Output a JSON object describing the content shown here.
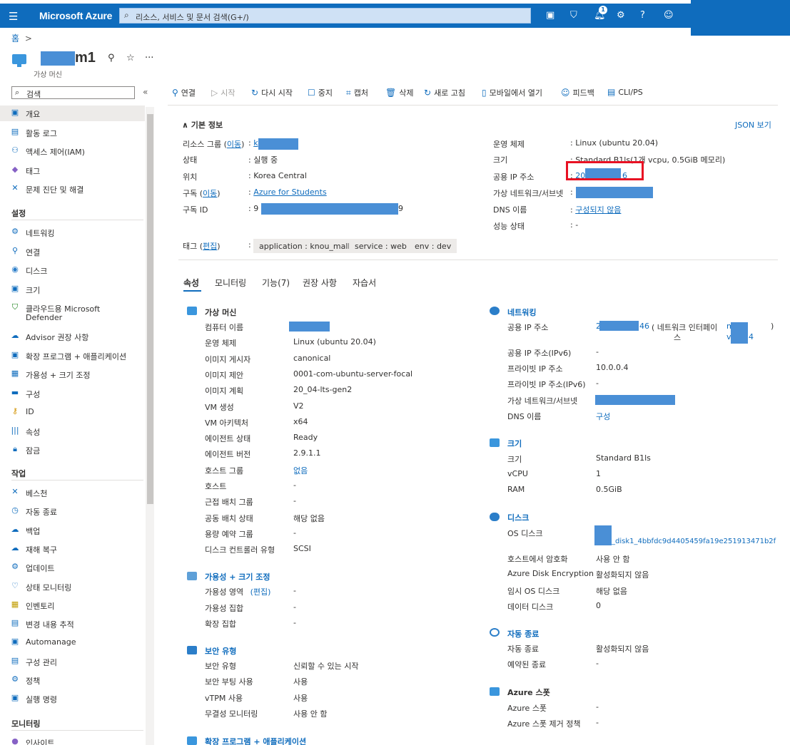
{
  "topbar": {
    "brand": "Microsoft Azure",
    "search_placeholder": "리소스, 서비스 및 문서 검색(G+/)",
    "notification_count": "1"
  },
  "breadcrumb": {
    "home": "홈",
    "sep": ">"
  },
  "header": {
    "title_suffix": "m1",
    "subtitle": "가상 머신"
  },
  "sidebar": {
    "search_placeholder": "검색",
    "items_top": [
      {
        "label": "개요",
        "icon": "monitor-icon",
        "selected": true
      },
      {
        "label": "활동 로그",
        "icon": "log-icon"
      },
      {
        "label": "액세스 제어(IAM)",
        "icon": "people-icon"
      },
      {
        "label": "태그",
        "icon": "tag-icon"
      },
      {
        "label": "문제 진단 및 해결",
        "icon": "wrench-icon"
      }
    ],
    "section_settings": "설정",
    "items_settings": [
      {
        "label": "네트워킹",
        "icon": "network-icon"
      },
      {
        "label": "연결",
        "icon": "connect-icon"
      },
      {
        "label": "디스크",
        "icon": "disk-icon"
      },
      {
        "label": "크기",
        "icon": "monitor-icon"
      },
      {
        "label": "클라우드용 Microsoft",
        "label2": "Defender",
        "icon": "shield-icon"
      },
      {
        "label": "Advisor 권장 사항",
        "icon": "advisor-icon"
      },
      {
        "label": "확장 프로그램 + 애플리케이션",
        "icon": "extension-icon"
      },
      {
        "label": "가용성 + 크기 조정",
        "icon": "scale-icon"
      },
      {
        "label": "구성",
        "icon": "config-icon"
      },
      {
        "label": "ID",
        "icon": "key-icon"
      },
      {
        "label": "속성",
        "icon": "properties-icon"
      },
      {
        "label": "잠금",
        "icon": "lock-icon"
      }
    ],
    "section_operations": "작업",
    "items_operations": [
      {
        "label": "베스천",
        "icon": "bastion-icon"
      },
      {
        "label": "자동 종료",
        "icon": "clock-icon"
      },
      {
        "label": "백업",
        "icon": "cloud-icon"
      },
      {
        "label": "재해 복구",
        "icon": "cloud-icon"
      },
      {
        "label": "업데이트",
        "icon": "gear-icon"
      },
      {
        "label": "상태 모니터링",
        "icon": "heart-icon"
      },
      {
        "label": "인벤토리",
        "icon": "box-icon"
      },
      {
        "label": "변경 내용 추적",
        "icon": "doc-icon"
      },
      {
        "label": "Automanage",
        "icon": "monitor-icon"
      },
      {
        "label": "구성 관리",
        "icon": "doc-icon"
      },
      {
        "label": "정책",
        "icon": "policy-icon"
      },
      {
        "label": "실행 명령",
        "icon": "terminal-icon"
      }
    ],
    "section_monitoring": "모니터링",
    "items_monitoring": [
      {
        "label": "인사이트",
        "icon": "bulb-icon"
      }
    ]
  },
  "toolbar": {
    "connect": "연결",
    "start": "시작",
    "restart": "다시 시작",
    "stop": "중지",
    "capture": "캡처",
    "delete": "삭제",
    "refresh": "새로 고침",
    "mobile": "모바일에서 열기",
    "feedback": "피드백",
    "cli": "CLI/PS"
  },
  "essentials": {
    "title": "기본 정보",
    "json_view": "JSON 보기",
    "left": {
      "resource_group_label": "리소스 그룹",
      "move": "이동",
      "status_label": "상태",
      "status_value": "실행 중",
      "location_label": "위치",
      "location_value": "Korea Central",
      "subscription_label": "구독",
      "subscription_value": "Azure for Students",
      "subscription_id_label": "구독 ID",
      "subscription_id_prefix": "9",
      "subscription_id_suffix": "9"
    },
    "right": {
      "os_label": "운영 체제",
      "os_value": "Linux (ubuntu 20.04)",
      "size_label": "크기",
      "size_value": "Standard B1ls(1개 vcpu, 0.5GiB 메모리)",
      "public_ip_label": "공용 IP 주소",
      "public_ip_prefix": "20",
      "public_ip_suffix": "6",
      "vnet_label": "가상 네트워크/서브넷",
      "dns_label": "DNS 이름",
      "dns_value": "구성되지 않음",
      "health_label": "성능 상태",
      "health_value": "-"
    },
    "tags_label": "태그",
    "tags_edit": "편집",
    "tags": [
      "application : knou_mall",
      "service : web",
      "env : dev"
    ]
  },
  "tabs": [
    "속성",
    "모니터링",
    "기능(7)",
    "권장 사항",
    "자습서"
  ],
  "properties": {
    "vm": {
      "title": "가상 머신",
      "rows": [
        [
          "컴퓨터 이름",
          ""
        ],
        [
          "운영 체제",
          "Linux (ubuntu 20.04)"
        ],
        [
          "이미지 게시자",
          "canonical"
        ],
        [
          "이미지 제안",
          "0001-com-ubuntu-server-focal"
        ],
        [
          "이미지 계획",
          "20_04-lts-gen2"
        ],
        [
          "VM 생성",
          "V2"
        ],
        [
          "VM 아키텍처",
          "x64"
        ],
        [
          "에이전트 상태",
          "Ready"
        ],
        [
          "에이전트 버전",
          "2.9.1.1"
        ],
        [
          "호스트 그룹",
          "없음"
        ],
        [
          "호스트",
          "-"
        ],
        [
          "근접 배치 그룹",
          "-"
        ],
        [
          "공동 배치 상태",
          "해당 없음"
        ],
        [
          "용량 예약 그룹",
          "-"
        ],
        [
          "디스크 컨트롤러 유형",
          "SCSI"
        ]
      ]
    },
    "availability": {
      "title": "가용성 + 크기 조정",
      "rows": [
        [
          "가용성 영역",
          "-"
        ],
        [
          "가용성 집합",
          "-"
        ],
        [
          "확장 집합",
          "-"
        ]
      ],
      "edit": "(편집)"
    },
    "security": {
      "title": "보안 유형",
      "rows": [
        [
          "보안 유형",
          "신뢰할 수 있는 시작"
        ],
        [
          "보안 부팅 사용",
          "사용"
        ],
        [
          "vTPM 사용",
          "사용"
        ],
        [
          "무결성 모니터링",
          "사용 안 함"
        ]
      ]
    },
    "extensions": {
      "title": "확장 프로그램 + 애플리케이션"
    },
    "networking": {
      "title": "네트워킹",
      "public_ip_label": "공용 IP 주소",
      "public_ip_prefix": "2",
      "public_ip_suffix": "46",
      "nic_text": "( 네트워크 인터페이",
      "nic_text2": "스",
      "nic_link1": "m",
      "nic_link2": "v",
      "nic_link3": "4",
      "close_paren": ")",
      "rows": [
        [
          "공용 IP 주소(IPv6)",
          "-"
        ],
        [
          "프라이빗 IP 주소",
          "10.0.0.4"
        ],
        [
          "프라이빗 IP 주소(IPv6)",
          "-"
        ]
      ],
      "vnet_label": "가상 네트워크/서브넷",
      "dns_label": "DNS 이름",
      "dns_value": "구성"
    },
    "size": {
      "title": "크기",
      "rows": [
        [
          "크기",
          "Standard B1ls"
        ],
        [
          "vCPU",
          "1"
        ],
        [
          "RAM",
          "0.5GiB"
        ]
      ]
    },
    "disk": {
      "title": "디스크",
      "os_disk_label": "OS 디스크",
      "os_disk_value": "_disk1_4bbfdc9d4405459fa19e251913471b2f",
      "rows": [
        [
          "호스트에서 암호화",
          "사용 안 함"
        ],
        [
          "Azure Disk Encryption",
          "활성화되지 않음"
        ],
        [
          "임시 OS 디스크",
          "해당 없음"
        ],
        [
          "데이터 디스크",
          "0"
        ]
      ]
    },
    "autoshutdown": {
      "title": "자동 종료",
      "rows": [
        [
          "자동 종료",
          "활성화되지 않음"
        ],
        [
          "예약된 종료",
          "-"
        ]
      ]
    },
    "spot": {
      "title": "Azure 스폿",
      "rows": [
        [
          "Azure 스폿",
          "-"
        ],
        [
          "Azure 스폿 제거 정책",
          "-"
        ]
      ]
    }
  }
}
